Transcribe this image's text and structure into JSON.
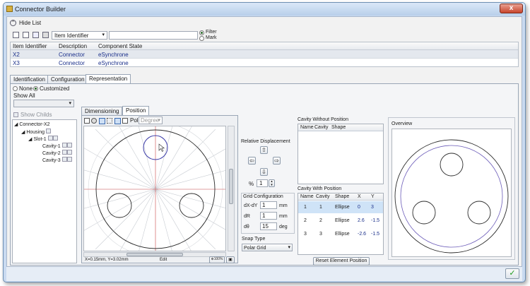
{
  "window": {
    "title": "Connector Builder",
    "close_glyph": "x",
    "ok_glyph": "✓"
  },
  "hide_list": {
    "label": "Hide List",
    "icon": "chevron-up-icon"
  },
  "toolbar": {
    "identifier_select": "Item Identifier",
    "search_value": "",
    "filter_label": "Filter",
    "mark_label": "Mark"
  },
  "top_table": {
    "columns": [
      "Item Identifier",
      "Description",
      "Component State"
    ],
    "rows": [
      {
        "id": "X2",
        "desc": "Connector",
        "state": "eSynchrone"
      },
      {
        "id": "X3",
        "desc": "Connector",
        "state": "eSynchrone"
      }
    ]
  },
  "main_tabs": [
    "Identification",
    "Configuration",
    "Representation"
  ],
  "left": {
    "none_label": "None",
    "customized_label": "Customized",
    "show_all_label": "Show All",
    "show_childs_label": "Show Childs",
    "tree": [
      {
        "label": "Connector-X2",
        "level": 0
      },
      {
        "label": "Housing",
        "level": 1
      },
      {
        "label": "Slot-1",
        "level": 2
      },
      {
        "label": "Cavity-1",
        "level": 3
      },
      {
        "label": "Cavity-2",
        "level": 3
      },
      {
        "label": "Cavity-3",
        "level": 3
      }
    ]
  },
  "sub_tabs": [
    "Dimensioning",
    "Position"
  ],
  "canvas": {
    "pol_label": "Pol",
    "unit_select": "Degree",
    "coords": "X=0.15mm, Y=3.02mm",
    "edit_label": "Edit",
    "zoom_label": "100%"
  },
  "relative_displacement": {
    "title": "Relative Displacement",
    "percent_label": "%",
    "percent_value": "1"
  },
  "grid_config": {
    "title": "Grid Configuration",
    "rows": [
      {
        "label": "dX-dY",
        "value": "1",
        "unit": "mm"
      },
      {
        "label": "dR",
        "value": "1",
        "unit": "mm"
      },
      {
        "label": "dθ",
        "value": "15",
        "unit": "deg"
      }
    ]
  },
  "snap": {
    "title": "Snap Type",
    "value": "Polar Grid"
  },
  "cavity_without": {
    "title": "Cavity Without Position",
    "columns": [
      "Name",
      "Cavity",
      "Shape"
    ]
  },
  "cavity_with": {
    "title": "Cavity With Position",
    "columns": [
      "Name",
      "Cavity",
      "Shape",
      "X",
      "Y"
    ],
    "rows": [
      {
        "name": "1",
        "cavity": "1",
        "shape": "Ellipse",
        "x": "0",
        "y": "3"
      },
      {
        "name": "2",
        "cavity": "2",
        "shape": "Ellipse",
        "x": "2.6",
        "y": "-1.5"
      },
      {
        "name": "3",
        "cavity": "3",
        "shape": "Ellipse",
        "x": "-2.6",
        "y": "-1.5"
      }
    ]
  },
  "reset_button": "Reset Element Position",
  "overview": {
    "title": "Overview"
  },
  "colors": {
    "selection": "#cfe3f7",
    "window_frame": "#c9daf0",
    "accent_link": "#1a2f8a"
  }
}
